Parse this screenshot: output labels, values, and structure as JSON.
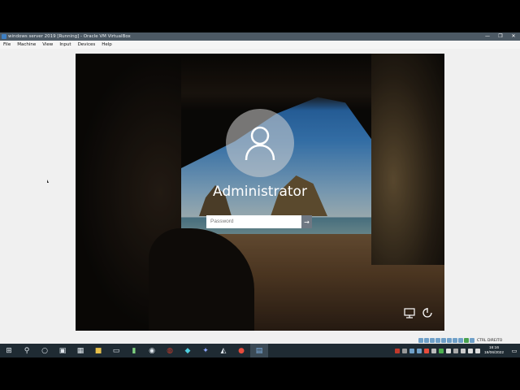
{
  "window": {
    "title": "windows server 2019 [Running] - Oracle VM VirtualBox",
    "controls": [
      "—",
      "❐",
      "✕"
    ]
  },
  "menu": {
    "items": [
      "File",
      "Machine",
      "View",
      "Input",
      "Devices",
      "Help"
    ]
  },
  "login": {
    "username": "Administrator",
    "password_placeholder": "Password",
    "submit_icon": "arrow-right-icon"
  },
  "status_bar": {
    "host_key": "CTRL DIREITO"
  },
  "taskbar": {
    "apps": [
      "windows-start",
      "search",
      "task-view",
      "store",
      "calculator",
      "explorer",
      "terminal",
      "notepad",
      "media",
      "app-red",
      "app-diamond",
      "app-game",
      "app-network",
      "app-recorder",
      "virtualbox"
    ],
    "clock_time": "16:16",
    "clock_date": "18/06/2022",
    "notification_icon": "message-icon"
  },
  "colors": {
    "titlebar": "#4c5964",
    "taskbar": "#1f2b33",
    "accent": "#3d7fc4"
  }
}
